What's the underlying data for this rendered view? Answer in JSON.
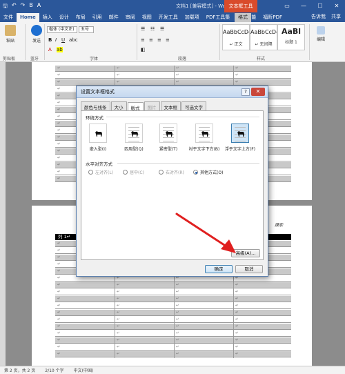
{
  "title_bar": {
    "title": "文档1 [兼容模式] - Word",
    "tool_tab_header": "文本框工具"
  },
  "ribbon_tabs": [
    {
      "label": "文件"
    },
    {
      "label": "Home"
    },
    {
      "label": "插入"
    },
    {
      "label": "设计"
    },
    {
      "label": "布局"
    },
    {
      "label": "引用"
    },
    {
      "label": "邮件"
    },
    {
      "label": "审阅"
    },
    {
      "label": "视图"
    },
    {
      "label": "开发工具"
    },
    {
      "label": "加载项"
    },
    {
      "label": "PDF工具集"
    },
    {
      "label": "特色功能"
    },
    {
      "label": "福昕PDF"
    },
    {
      "label": "格式"
    }
  ],
  "ribbon_right": {
    "tell_me": "告诉我",
    "share": "共享"
  },
  "ribbon": {
    "paste": "粘贴",
    "send": "发送",
    "bluetooth": "蓝牙",
    "clipboard": "剪贴板",
    "font_name": "楷体 (中文正)",
    "font_size": "五号",
    "font_group": "字体",
    "paragraph_group": "段落",
    "styles_group": "样式",
    "edit_label": "编辑",
    "styles": [
      {
        "preview": "AaBbCcDd",
        "name": "↵ 正文"
      },
      {
        "preview": "AaBbCcDd",
        "name": "↵ 无间隔"
      },
      {
        "preview": "AaBl",
        "name": "标题 1"
      }
    ]
  },
  "document": {
    "table_header": "列 1↵",
    "cell_mark": "↵",
    "margin_text": "摸索"
  },
  "dialog": {
    "title": "设置文本框格式",
    "help": "?",
    "close": "✕",
    "tabs": [
      {
        "label": "颜色与线条",
        "state": "normal"
      },
      {
        "label": "大小",
        "state": "normal"
      },
      {
        "label": "版式",
        "state": "active"
      },
      {
        "label": "图片",
        "state": "disabled"
      },
      {
        "label": "文本框",
        "state": "normal"
      },
      {
        "label": "可选文字",
        "state": "normal"
      }
    ],
    "wrap_section": "环绕方式",
    "wrap_options": [
      {
        "label": "嵌入型(I)",
        "selected": false
      },
      {
        "label": "四周型(Q)",
        "selected": false
      },
      {
        "label": "紧密型(T)",
        "selected": false
      },
      {
        "label": "衬于文字下方(B)",
        "selected": false
      },
      {
        "label": "浮于文字上方(F)",
        "selected": true
      }
    ],
    "align_section": "水平对齐方式",
    "align_options": [
      {
        "label": "左对齐(L)",
        "checked": false,
        "disabled": true
      },
      {
        "label": "居中(C)",
        "checked": false,
        "disabled": true
      },
      {
        "label": "右对齐(R)",
        "checked": false,
        "disabled": true
      },
      {
        "label": "其他方式(O)",
        "checked": true,
        "disabled": false
      }
    ],
    "advanced_button": "高级(A)...",
    "ok_button": "确定",
    "cancel_button": "取消"
  },
  "status_bar": {
    "page": "第 2 页，共 2 页",
    "words": "2/10 个字",
    "language": "中文(中国)"
  },
  "colors": {
    "word_blue": "#2b579a",
    "tool_tab": "#d94b2b",
    "selection": "#cfe5f7",
    "arrow": "#e02020"
  }
}
